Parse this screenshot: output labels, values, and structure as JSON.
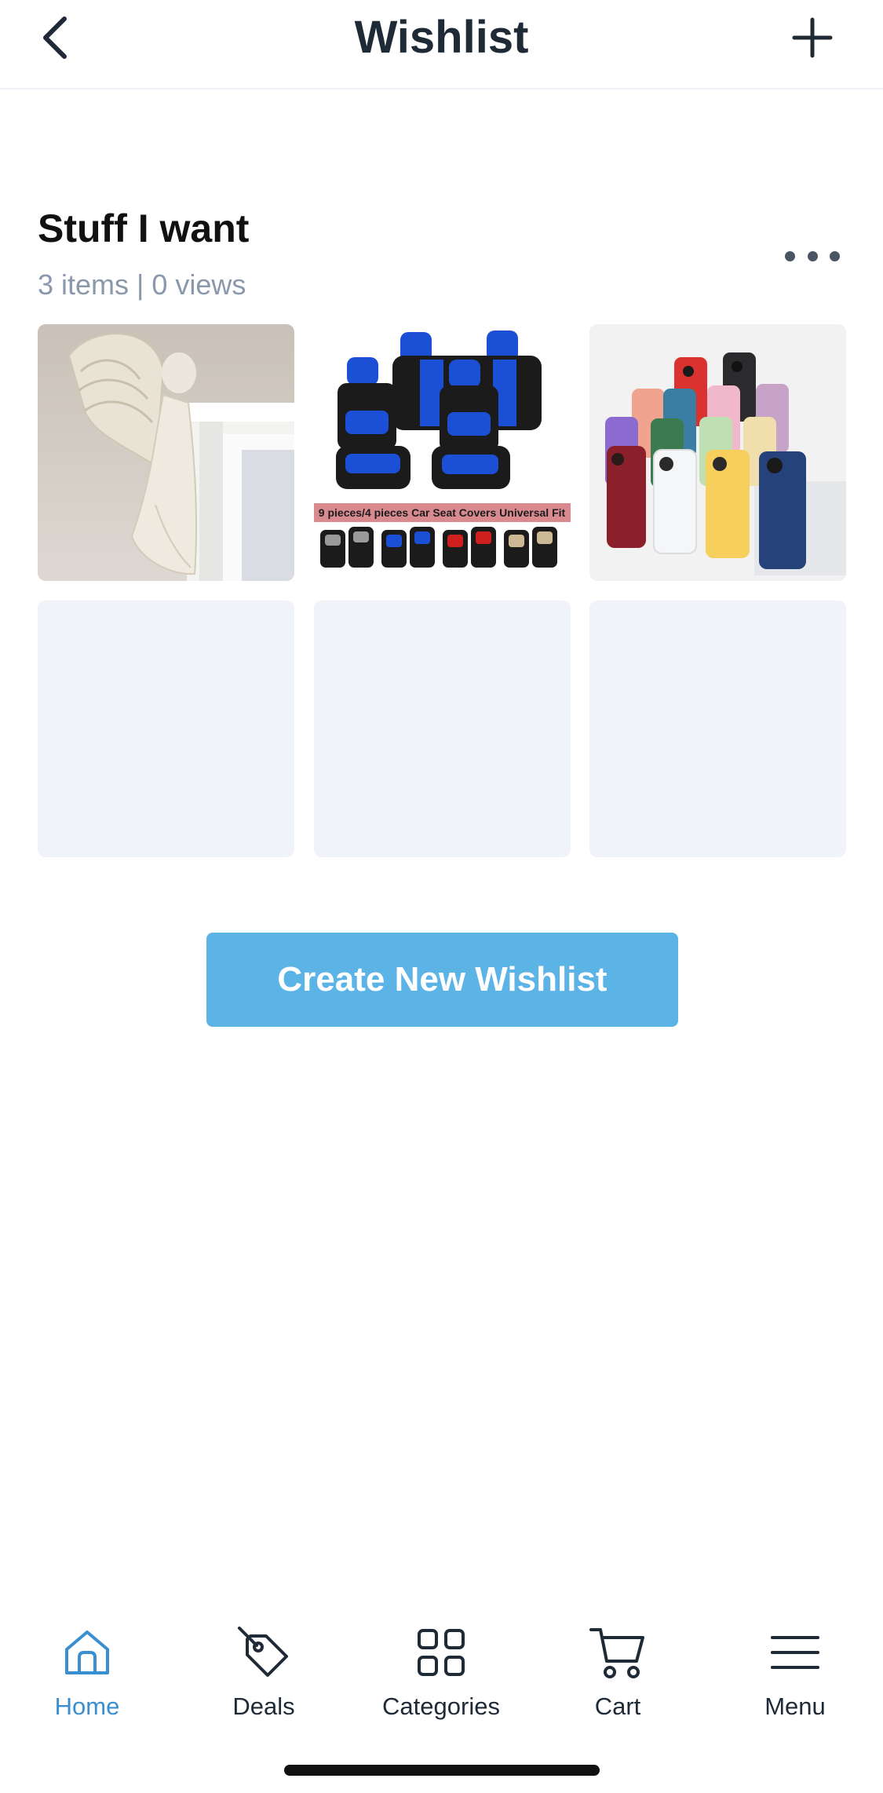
{
  "header": {
    "title": "Wishlist",
    "back_icon": "chevron-left-icon",
    "add_icon": "plus-icon"
  },
  "wishlist": {
    "name": "Stuff I want",
    "meta": "3 items | 0 views",
    "more_icon": "more-horizontal-icon",
    "items": [
      {
        "image": "angel-door-frame-statue",
        "caption": ""
      },
      {
        "image": "car-seat-covers",
        "caption": "9 pieces/4 pieces Car Seat Covers Universal Fit"
      },
      {
        "image": "colorful-phone-cases",
        "caption": ""
      },
      {
        "image": "empty"
      },
      {
        "image": "empty"
      },
      {
        "image": "empty"
      }
    ]
  },
  "create_button": {
    "label": "Create New Wishlist"
  },
  "tabbar": {
    "items": [
      {
        "label": "Home",
        "icon": "home-icon",
        "active": true
      },
      {
        "label": "Deals",
        "icon": "tag-icon",
        "active": false
      },
      {
        "label": "Categories",
        "icon": "grid-icon",
        "active": false
      },
      {
        "label": "Cart",
        "icon": "cart-icon",
        "active": false
      },
      {
        "label": "Menu",
        "icon": "hamburger-menu-icon",
        "active": false
      }
    ]
  },
  "colors": {
    "accent": "#5cb3e6",
    "active_tab": "#3a8fd0",
    "meta_text": "#8a98ab",
    "placeholder_tile": "#f0f3f7"
  }
}
